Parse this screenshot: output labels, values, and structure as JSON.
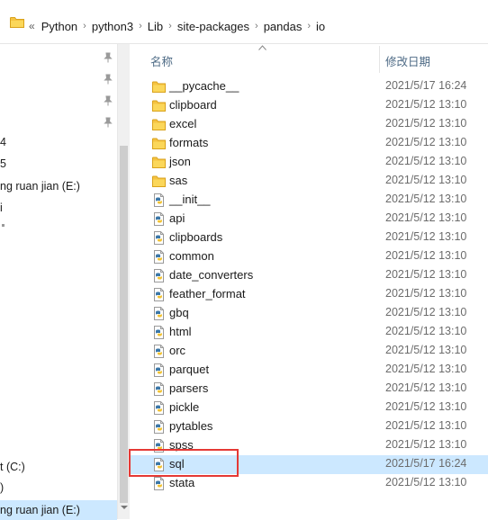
{
  "address_bar": {
    "overflow": "«",
    "breadcrumbs": [
      "Python",
      "python3",
      "Lib",
      "site-packages",
      "pandas",
      "io"
    ]
  },
  "nav_pane": {
    "items": [
      {
        "label": "4"
      },
      {
        "label": "5"
      },
      {
        "label": "ng ruan jian (E:)"
      },
      {
        "label": "i"
      },
      {
        "label": "t (C:)"
      },
      {
        "label": ")"
      },
      {
        "label": "ng ruan jian (E:)"
      }
    ]
  },
  "columns": {
    "name": "名称",
    "date_modified": "修改日期"
  },
  "files": [
    {
      "name": "__pycache__",
      "date": "2021/5/17 16:24",
      "type": "folder"
    },
    {
      "name": "clipboard",
      "date": "2021/5/12 13:10",
      "type": "folder"
    },
    {
      "name": "excel",
      "date": "2021/5/12 13:10",
      "type": "folder"
    },
    {
      "name": "formats",
      "date": "2021/5/12 13:10",
      "type": "folder"
    },
    {
      "name": "json",
      "date": "2021/5/12 13:10",
      "type": "folder"
    },
    {
      "name": "sas",
      "date": "2021/5/12 13:10",
      "type": "folder"
    },
    {
      "name": "__init__",
      "date": "2021/5/12 13:10",
      "type": "python"
    },
    {
      "name": "api",
      "date": "2021/5/12 13:10",
      "type": "python"
    },
    {
      "name": "clipboards",
      "date": "2021/5/12 13:10",
      "type": "python"
    },
    {
      "name": "common",
      "date": "2021/5/12 13:10",
      "type": "python"
    },
    {
      "name": "date_converters",
      "date": "2021/5/12 13:10",
      "type": "python"
    },
    {
      "name": "feather_format",
      "date": "2021/5/12 13:10",
      "type": "python"
    },
    {
      "name": "gbq",
      "date": "2021/5/12 13:10",
      "type": "python"
    },
    {
      "name": "html",
      "date": "2021/5/12 13:10",
      "type": "python"
    },
    {
      "name": "orc",
      "date": "2021/5/12 13:10",
      "type": "python"
    },
    {
      "name": "parquet",
      "date": "2021/5/12 13:10",
      "type": "python"
    },
    {
      "name": "parsers",
      "date": "2021/5/12 13:10",
      "type": "python"
    },
    {
      "name": "pickle",
      "date": "2021/5/12 13:10",
      "type": "python"
    },
    {
      "name": "pytables",
      "date": "2021/5/12 13:10",
      "type": "python"
    },
    {
      "name": "spss",
      "date": "2021/5/12 13:10",
      "type": "python"
    },
    {
      "name": "sql",
      "date": "2021/5/17 16:24",
      "type": "python",
      "selected": true
    },
    {
      "name": "stata",
      "date": "2021/5/12 13:10",
      "type": "python"
    }
  ],
  "colors": {
    "selection": "#cce8ff",
    "highlight_box": "#e53935",
    "folder": "#f5c342"
  }
}
